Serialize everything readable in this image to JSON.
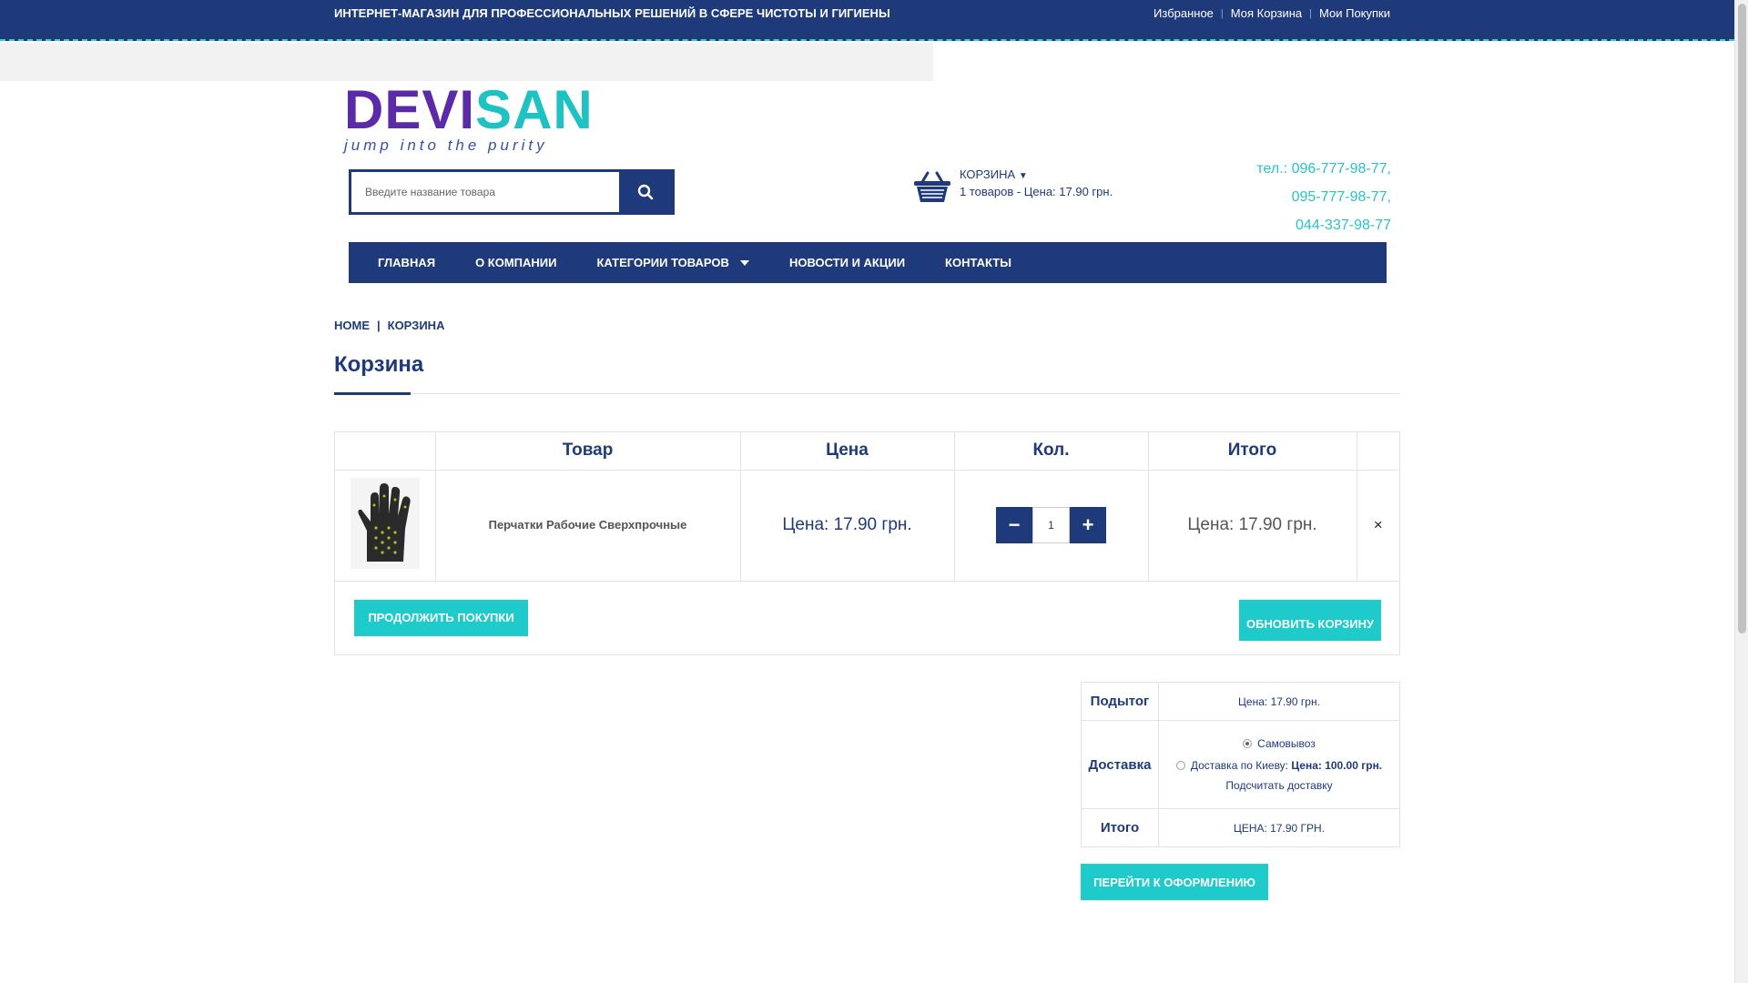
{
  "topbar": {
    "tagline": "ИНТЕРНЕТ-МАГАЗИН ДЛЯ ПРОФЕССИОНАЛЬНЫХ РЕШЕНИЙ В СФЕРЕ ЧИСТОТЫ И ГИГИЕНЫ",
    "links": [
      "Избранное",
      "Моя Корзина",
      "Мои Покупки"
    ]
  },
  "logo": {
    "word_a": "DEVI",
    "word_b": "SAN",
    "slogan": "jump into the purity"
  },
  "search": {
    "placeholder": "Введите название товара",
    "icon": "search-icon"
  },
  "cart_widget": {
    "title": "КОРЗИНА",
    "summary": "1 товаров - Цена: 17.90 грн.",
    "icon": "basket-icon"
  },
  "phones": [
    "тел.: 096-777-98-77,",
    "095-777-98-77,",
    "044-337-98-77"
  ],
  "nav": {
    "items": [
      "ГЛАВНАЯ",
      "О КОМПАНИИ",
      "КАТЕГОРИИ ТОВАРОВ",
      "НОВОСТИ И АКЦИИ",
      "КОНТАКТЫ"
    ]
  },
  "breadcrumb": {
    "home": "HOME",
    "sep": "|",
    "current": "КОРЗИНА"
  },
  "page": {
    "title": "Корзина"
  },
  "cart": {
    "headers": [
      "",
      "Товар",
      "Цена",
      "Кол.",
      "Итого",
      ""
    ],
    "rows": [
      {
        "name": "Перчатки Рабочие Сверхпрочные",
        "price": "Цена: 17.90 грн.",
        "qty": "1",
        "total": "Цена: 17.90 грн.",
        "remove": "×"
      }
    ],
    "qty_minus": "−",
    "qty_plus": "+",
    "continue_label": "ПРОДОЛЖИТЬ ПОКУПКИ",
    "update_label": "ОБНОВИТЬ КОРЗИНУ"
  },
  "totals": {
    "subtotal_label": "Подытог",
    "subtotal_value": "Цена: 17.90 грн.",
    "delivery_label": "Доставка",
    "delivery_option1": "Самовывоз",
    "delivery_option2": "Доставка по Киеву: ",
    "delivery_option2_price": "Цена: 100.00 грн.",
    "calc_link": "Подсчитать доставку",
    "total_label": "Итого",
    "total_value": "ЦЕНА: 17.90 ГРН."
  },
  "checkout_label": "ПЕРЕЙТИ К ОФОРМЛЕНИЮ",
  "colors": {
    "navy": "#1f3a7a",
    "teal": "#1fcaca",
    "purple": "#5b2aa8"
  }
}
